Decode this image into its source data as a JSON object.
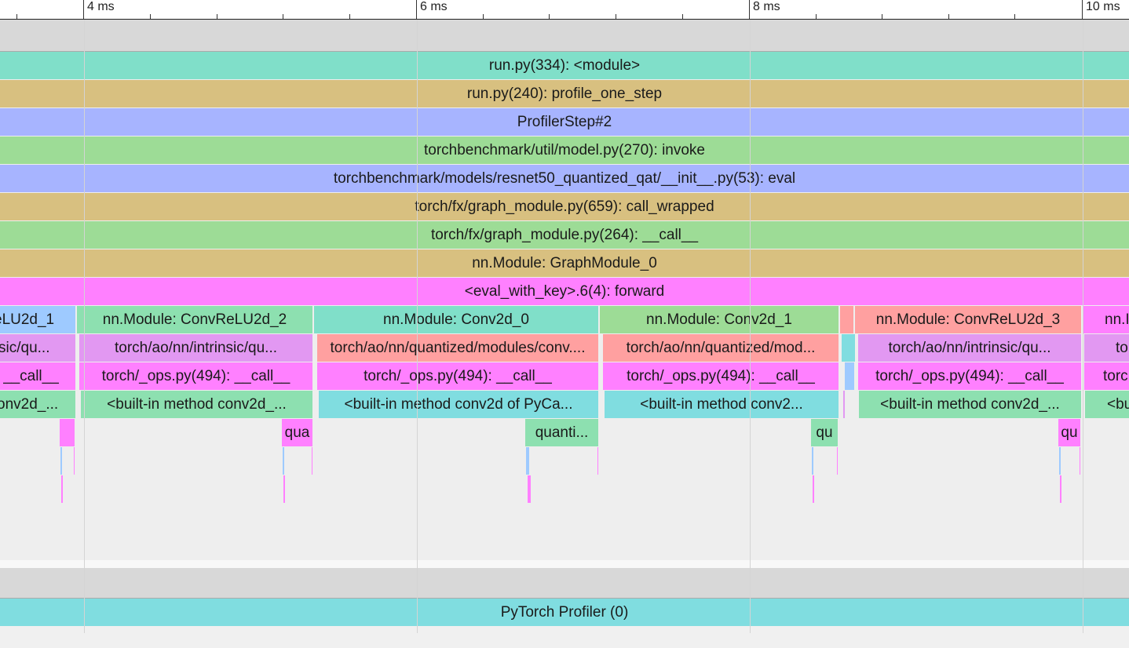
{
  "ruler": {
    "ticks": [
      "4 ms",
      "6 ms",
      "8 ms",
      "10 ms"
    ]
  },
  "colors": {
    "teal": "#80dfc9",
    "tan": "#d8c080",
    "periwinkle": "#a7b4ff",
    "green": "#9ddc96",
    "magenta": "#ff80ff",
    "blue": "#9ecaff",
    "lilac": "#e298f2",
    "salmon": "#ffa0a0",
    "cyan": "#80dde0",
    "mint": "#8de0b0",
    "pink": "#f68cdf"
  },
  "main_track": {
    "rows": [
      {
        "label": "run.py(334): <module>"
      },
      {
        "label": "run.py(240): profile_one_step"
      },
      {
        "label": "ProfilerStep#2"
      },
      {
        "label": "torchbenchmark/util/model.py(270): invoke"
      },
      {
        "label": "torchbenchmark/models/resnet50_quantized_qat/__init__.py(53): eval"
      },
      {
        "label": "torch/fx/graph_module.py(659): call_wrapped"
      },
      {
        "label": "torch/fx/graph_module.py(264): __call__"
      },
      {
        "label": "nn.Module: GraphModule_0"
      },
      {
        "label": "<eval_with_key>.6(4): forward"
      }
    ],
    "modules": [
      {
        "label": "eLU2d_1"
      },
      {
        "label": "nn.Module: ConvReLU2d_2"
      },
      {
        "label": "nn.Module: Conv2d_0"
      },
      {
        "label": "nn.Module: Conv2d_1"
      },
      {
        "label": "nn.Module: ConvReLU2d_3"
      },
      {
        "label": "nn.I"
      }
    ],
    "impls": [
      {
        "label": "sic/qu..."
      },
      {
        "label": "torch/ao/nn/intrinsic/qu..."
      },
      {
        "label": "torch/ao/nn/quantized/modules/conv...."
      },
      {
        "label": "torch/ao/nn/quantized/mod..."
      },
      {
        "label": "torch/ao/nn/intrinsic/qu..."
      },
      {
        "label": "to"
      }
    ],
    "calls": [
      {
        "label": "__call__"
      },
      {
        "label": "torch/_ops.py(494): __call__"
      },
      {
        "label": "torch/_ops.py(494): __call__"
      },
      {
        "label": "torch/_ops.py(494): __call__"
      },
      {
        "label": "torch/_ops.py(494): __call__"
      },
      {
        "label": "torc"
      }
    ],
    "builtins": [
      {
        "label": "onv2d_..."
      },
      {
        "label": "<built-in method conv2d_..."
      },
      {
        "label": "<built-in method conv2d of PyCa..."
      },
      {
        "label": "<built-in method conv2..."
      },
      {
        "label": "<built-in method conv2d_..."
      },
      {
        "label": "<bu"
      }
    ],
    "quants": [
      {
        "label": "qua"
      },
      {
        "label": "quanti..."
      },
      {
        "label": "qu"
      },
      {
        "label": "qu"
      }
    ]
  },
  "profiler_track": {
    "label": "PyTorch Profiler (0)"
  }
}
